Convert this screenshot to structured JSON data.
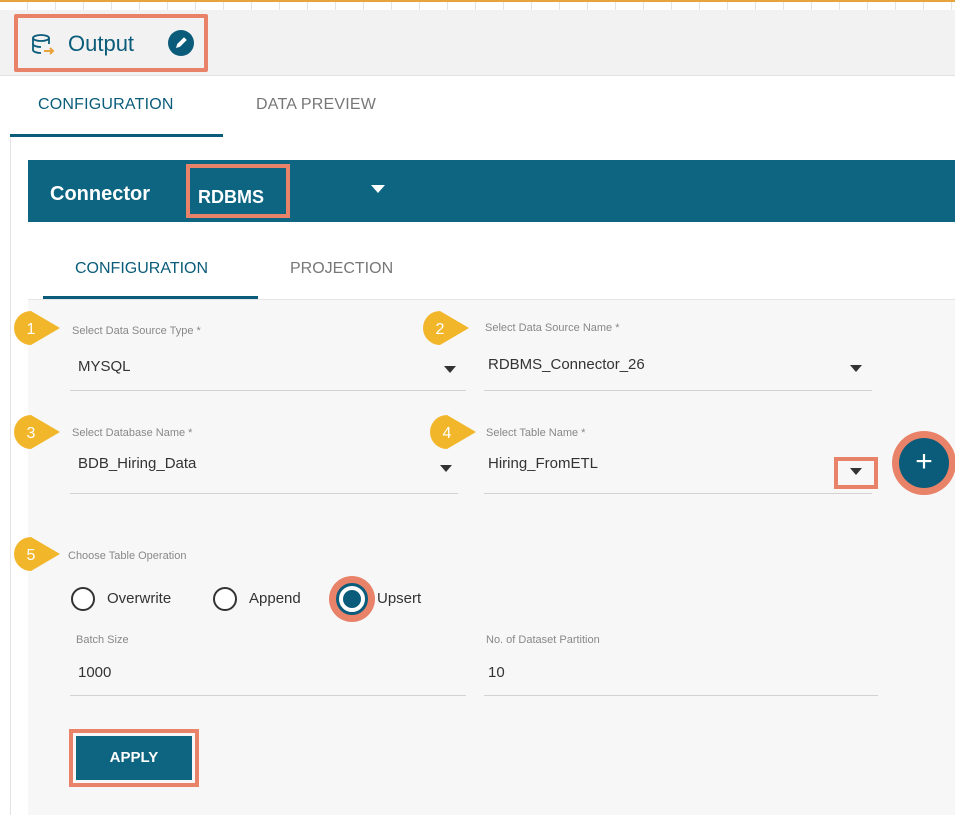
{
  "header": {
    "title": "Output"
  },
  "main_tabs": [
    {
      "label": "CONFIGURATION"
    },
    {
      "label": "DATA PREVIEW"
    }
  ],
  "connector": {
    "label": "Connector",
    "selected": "RDBMS"
  },
  "sub_tabs": [
    {
      "label": "CONFIGURATION"
    },
    {
      "label": "PROJECTION"
    }
  ],
  "badges": [
    "1",
    "2",
    "3",
    "4",
    "5"
  ],
  "fields": {
    "data_source_type": {
      "label": "Select Data Source Type *",
      "value": "MYSQL"
    },
    "data_source_name": {
      "label": "Select Data Source Name *",
      "value": "RDBMS_Connector_26"
    },
    "database_name": {
      "label": "Select Database Name *",
      "value": "BDB_Hiring_Data"
    },
    "table_name": {
      "label": "Select Table Name *",
      "value": "Hiring_FromETL"
    },
    "batch_size": {
      "label": "Batch Size",
      "value": "1000"
    },
    "partitions": {
      "label": "No. of Dataset Partition",
      "value": "10"
    }
  },
  "table_operation": {
    "label": "Choose Table Operation",
    "options": [
      "Overwrite",
      "Append",
      "Upsert"
    ],
    "selected": "Upsert"
  },
  "apply_label": "APPLY",
  "colors": {
    "primary": "#0e6581",
    "highlight": "#e8836a",
    "badge": "#f2b62b"
  }
}
